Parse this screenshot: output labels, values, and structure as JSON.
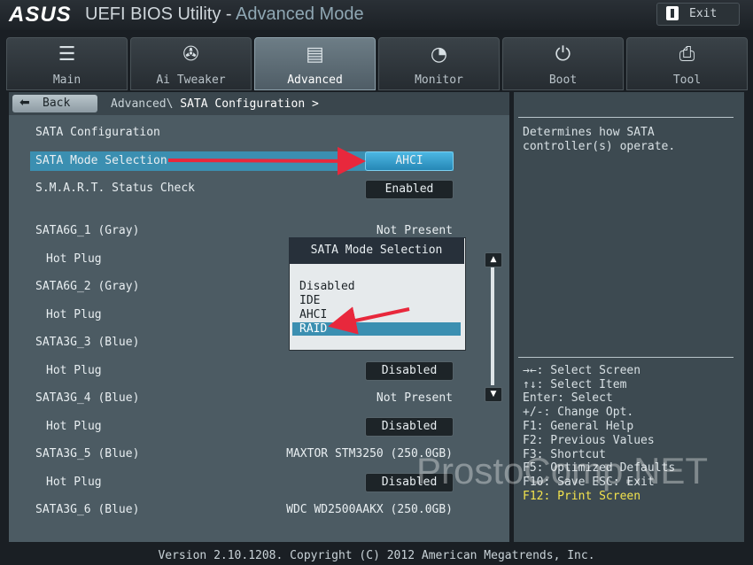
{
  "header": {
    "logo": "ASUS",
    "title_main": "UEFI BIOS Utility - ",
    "title_mode": "Advanced Mode",
    "exit_label": "Exit"
  },
  "tabs": [
    {
      "label": "Main",
      "icon": "list-icon"
    },
    {
      "label": "Ai Tweaker",
      "icon": "fan-icon"
    },
    {
      "label": "Advanced",
      "icon": "settings-info-icon",
      "active": true
    },
    {
      "label": "Monitor",
      "icon": "monitor-gauge-icon"
    },
    {
      "label": "Boot",
      "icon": "power-icon"
    },
    {
      "label": "Tool",
      "icon": "printer-icon"
    }
  ],
  "nav": {
    "back_label": "Back",
    "crumb_parent": "Advanced\\",
    "crumb_current": "SATA Configuration >"
  },
  "settings": {
    "section_title": "SATA Configuration",
    "rows": [
      {
        "label": "SATA Mode Selection",
        "value": "AHCI"
      },
      {
        "label": "S.M.A.R.T. Status Check",
        "value": "Enabled"
      },
      {
        "label": "SATA6G_1 (Gray)",
        "value": "Not Present"
      },
      {
        "label": "Hot Plug",
        "value": ""
      },
      {
        "label": "SATA6G_2 (Gray)",
        "value": ""
      },
      {
        "label": "Hot Plug",
        "value": ""
      },
      {
        "label": "SATA3G_3 (Blue)",
        "value": ""
      },
      {
        "label": "Hot Plug",
        "value": "Disabled"
      },
      {
        "label": "SATA3G_4 (Blue)",
        "value": "Not Present"
      },
      {
        "label": "Hot Plug",
        "value": "Disabled"
      },
      {
        "label": "SATA3G_5 (Blue)",
        "value": "MAXTOR STM3250 (250.0GB)"
      },
      {
        "label": "Hot Plug",
        "value": "Disabled"
      },
      {
        "label": "SATA3G_6 (Blue)",
        "value": "WDC WD2500AAKX (250.0GB)"
      }
    ]
  },
  "popup": {
    "title": "SATA Mode Selection",
    "options": [
      "Disabled",
      "IDE",
      "AHCI",
      "RAID"
    ],
    "selected": "RAID"
  },
  "help": {
    "text": "Determines how SATA controller(s) operate."
  },
  "keys": [
    "→←: Select Screen",
    "↑↓: Select Item",
    "Enter: Select",
    "+/-: Change Opt.",
    "F1: General Help",
    "F2: Previous Values",
    "F3: Shortcut",
    "F5: Optimized Defaults",
    "F10: Save  ESC: Exit",
    "F12: Print Screen"
  ],
  "footer": {
    "version": "Version 2.10.1208. Copyright (C) 2012 American Megatrends, Inc."
  },
  "watermark": "ProstoComp.NET",
  "colors": {
    "highlight": "#3b8fb1",
    "arrow": "#e8283c",
    "f12": "#f3e34d"
  }
}
